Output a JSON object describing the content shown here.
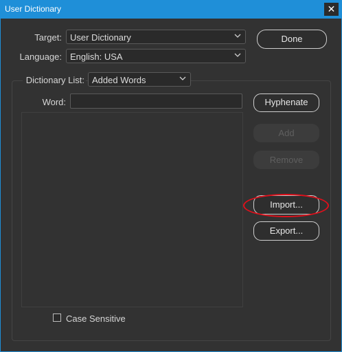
{
  "window": {
    "title": "User Dictionary",
    "close_glyph": "✕"
  },
  "target": {
    "label": "Target:",
    "value": "User Dictionary"
  },
  "language": {
    "label": "Language:",
    "value": "English: USA"
  },
  "dictionary_list": {
    "label": "Dictionary List:",
    "value": "Added Words"
  },
  "word": {
    "label": "Word:",
    "value": ""
  },
  "buttons": {
    "done": "Done",
    "hyphenate": "Hyphenate",
    "add": "Add",
    "remove": "Remove",
    "import": "Import...",
    "export": "Export..."
  },
  "case_sensitive": {
    "label": "Case Sensitive",
    "checked": false
  },
  "colors": {
    "title_bar": "#1f8fd8",
    "highlight": "#e0101b",
    "background": "#323232"
  }
}
